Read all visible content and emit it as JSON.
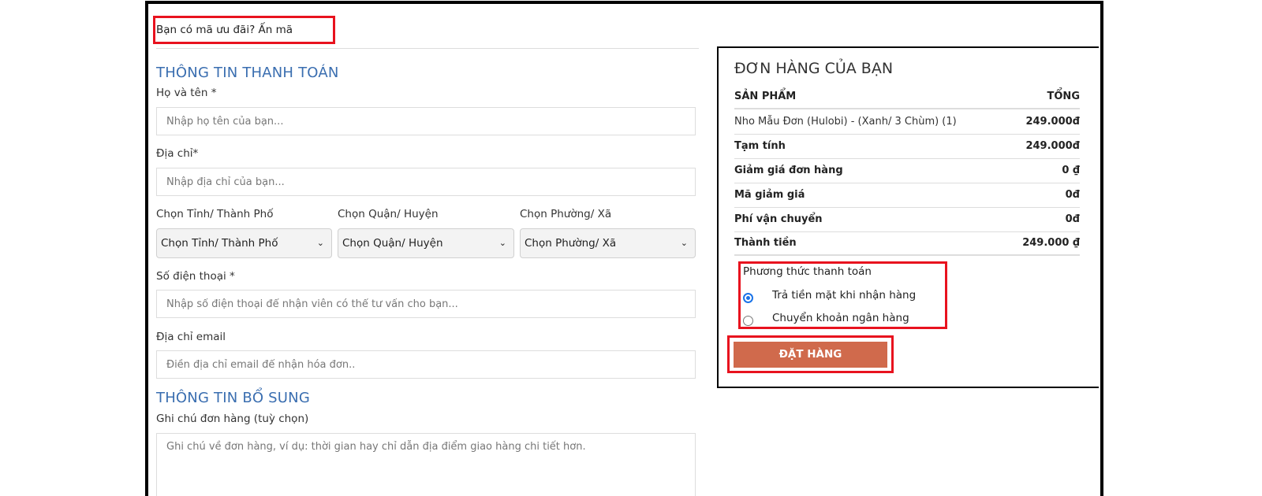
{
  "coupon": {
    "question": "Bạn có mã ưu đãi?",
    "link": "Ấn mã"
  },
  "billing": {
    "title": "THÔNG TIN THANH TOÁN",
    "name_label": "Họ và tên *",
    "name_placeholder": "Nhập họ tên của bạn...",
    "address_label": "Địa chỉ*",
    "address_placeholder": "Nhập địa chỉ của bạn...",
    "province_label": "Chọn Tỉnh/ Thành Phố",
    "province_value": "Chọn Tỉnh/ Thành Phố",
    "district_label": "Chọn Quận/ Huyện",
    "district_value": "Chọn Quận/ Huyện",
    "ward_label": "Chọn Phường/ Xã",
    "ward_value": "Chọn Phường/ Xã",
    "phone_label": "Số điện thoại *",
    "phone_placeholder": "Nhập số điện thoại để nhận viên có thể tư vấn cho bạn...",
    "email_label": "Địa chỉ email",
    "email_placeholder": "Điền địa chỉ email để nhận hóa đơn.."
  },
  "additional": {
    "title": "THÔNG TIN BỔ SUNG",
    "note_label": "Ghi chú đơn hàng (tuỳ chọn)",
    "note_placeholder": "Ghi chú về đơn hàng, ví dụ: thời gian hay chỉ dẫn địa điểm giao hàng chi tiết hơn."
  },
  "order": {
    "title": "ĐƠN HÀNG CỦA BẠN",
    "col_product": "SẢN PHẨM",
    "col_total": "TỔNG",
    "item_name": "Nho Mẫu Đơn (Hulobi) - (Xanh/ 3 Chùm) (1)",
    "item_total": "249.000đ",
    "subtotal_label": "Tạm tính",
    "subtotal_value": "249.000đ",
    "discount_label": "Giảm giá đơn hàng",
    "discount_value": "0 ₫",
    "coupon_label": "Mã giảm giá",
    "coupon_value": "0đ",
    "shipping_label": "Phí vận chuyển",
    "shipping_value": "0đ",
    "grand_label": "Thành tiền",
    "grand_value": "249.000 ₫"
  },
  "payment": {
    "title": "Phương thức thanh toán",
    "options": [
      {
        "label": "Trả tiền mặt khi nhận hàng",
        "selected": true
      },
      {
        "label": "Chuyển khoản ngân hàng",
        "selected": false
      }
    ]
  },
  "submit_label": "ĐẶT HÀNG",
  "colors": {
    "heading_blue": "#3a6eb0",
    "button": "#d06a4c",
    "highlight_red": "#e8121e",
    "radio_blue": "#1a73e8"
  }
}
